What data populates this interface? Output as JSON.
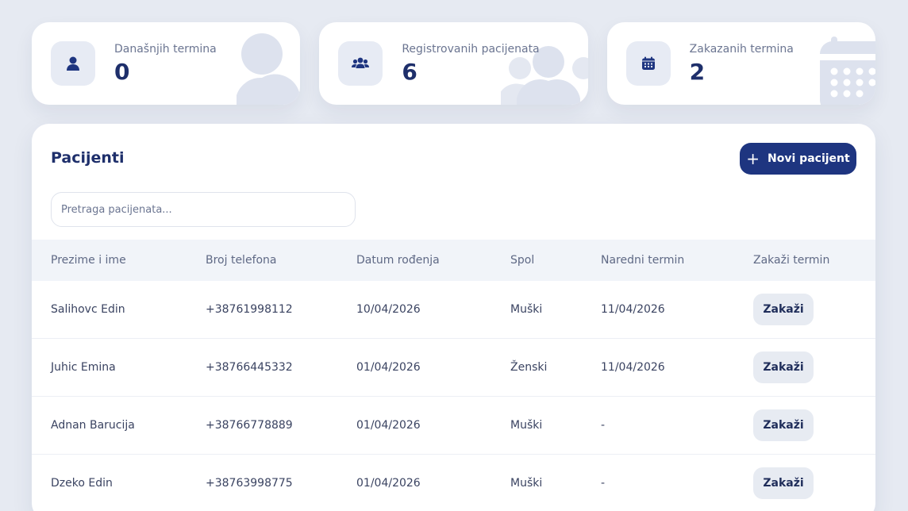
{
  "stats": [
    {
      "label": "Današnjih termina",
      "value": "0",
      "icon": "user-icon"
    },
    {
      "label": "Registrovanih pacijenata",
      "value": "6",
      "icon": "users-icon"
    },
    {
      "label": "Zakazanih termina",
      "value": "2",
      "icon": "calendar-icon"
    }
  ],
  "patients": {
    "title": "Pacijenti",
    "new_button_label": "Novi pacijent",
    "search_placeholder": "Pretraga pacijenata...",
    "columns": [
      "Prezime i ime",
      "Broj telefona",
      "Datum rođenja",
      "Spol",
      "Naredni termin",
      "Zakaži termin"
    ],
    "book_label": "Zakaži",
    "rows": [
      {
        "name": "Salihovc Edin",
        "phone": "+38761998112",
        "dob": "10/04/2026",
        "sex": "Muški",
        "next": "11/04/2026"
      },
      {
        "name": "Juhic Emina",
        "phone": "+38766445332",
        "dob": "01/04/2026",
        "sex": "Ženski",
        "next": "11/04/2026"
      },
      {
        "name": "Adnan Barucija",
        "phone": "+38766778889",
        "dob": "01/04/2026",
        "sex": "Muški",
        "next": "-"
      },
      {
        "name": "Dzeko Edin",
        "phone": "+38763998775",
        "dob": "01/04/2026",
        "sex": "Muški",
        "next": "-"
      }
    ]
  },
  "colors": {
    "accent": "#1e3580",
    "background": "#e6eaf2",
    "card": "#ffffff",
    "icon_box": "#e7ebf4"
  }
}
